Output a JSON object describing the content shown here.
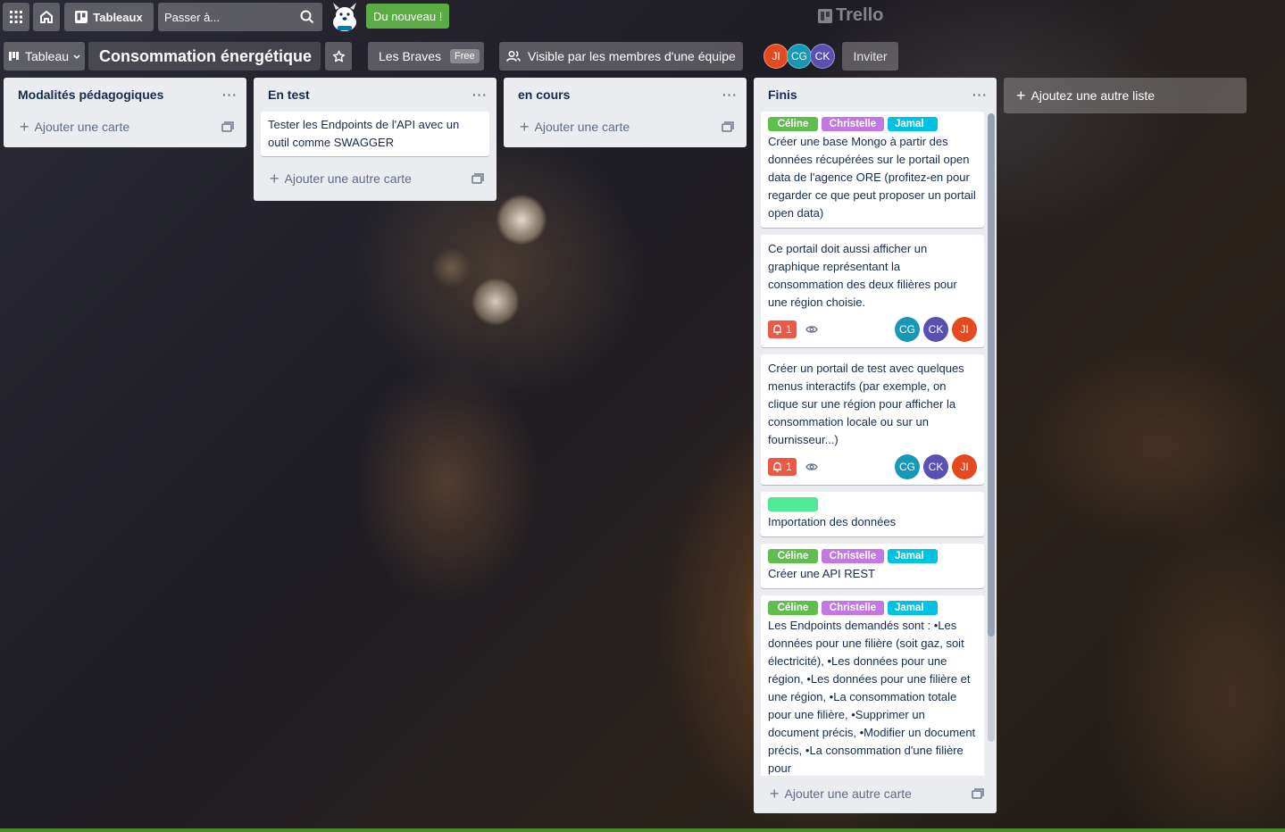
{
  "nav": {
    "boards_label": "Tableaux",
    "search_placeholder": "Passer à...",
    "news_label": "Du nouveau !",
    "logo_text": "Trello"
  },
  "board": {
    "view_label": "Tableau",
    "title": "Consommation énergétique",
    "team_name": "Les Braves",
    "team_plan": "Free",
    "visibility": "Visible par les membres d'une équipe",
    "invite_label": "Inviter",
    "members": [
      {
        "initials": "JI",
        "color": "#e44a1f"
      },
      {
        "initials": "CG",
        "color": "#1798b5"
      },
      {
        "initials": "CK",
        "color": "#5b4fb1"
      }
    ]
  },
  "colors": {
    "label_green": "#61bd4f",
    "label_purple": "#c377e0",
    "label_sky": "#00c2e0",
    "label_lime": "#51e898"
  },
  "lists": [
    {
      "title": "Modalités pédagogiques",
      "add_label": "Ajouter une carte"
    },
    {
      "title": "En test",
      "add_label": "Ajouter une autre carte",
      "cards": [
        {
          "text": "Tester les Endpoints de l'API avec un outil comme SWAGGER"
        }
      ]
    },
    {
      "title": "en cours",
      "add_label": "Ajouter une carte"
    },
    {
      "title": "Finis",
      "add_label": "Ajouter une autre carte",
      "cards": [
        {
          "labels": [
            "Céline",
            "Christelle",
            "Jamal"
          ],
          "text": "Créer une base Mongo à partir des données récupérées sur le portail open data de l'agence ORE (profitez-en pour regarder ce que peut proposer un portail open data)"
        },
        {
          "text": "Ce portail doit aussi afficher un graphique représentant la consommation des deux filières pour une région choisie.",
          "notifications": "1",
          "members": [
            "CG",
            "CK",
            "JI"
          ]
        },
        {
          "text": "Créer un portail de test avec quelques menus interactifs (par exemple, on clique sur une région pour afficher la consommation locale ou sur un fournisseur...)",
          "notifications": "1",
          "members": [
            "CG",
            "CK",
            "JI"
          ]
        },
        {
          "text": "Importation des données"
        },
        {
          "labels": [
            "Céline",
            "Christelle",
            "Jamal"
          ],
          "text": "Créer une API REST"
        },
        {
          "labels": [
            "Céline",
            "Christelle",
            "Jamal"
          ],
          "text": "Les Endpoints demandés sont : •Les données pour une filière (soit gaz, soit électricité), •Les données pour une région, •Les données pour une filière et une région, •La consommation totale pour une filière, •Supprimer un document précis, •Modifier un document précis, •La consommation d'une filière pour"
        }
      ]
    }
  ],
  "add_list_label": "Ajoutez une autre liste"
}
